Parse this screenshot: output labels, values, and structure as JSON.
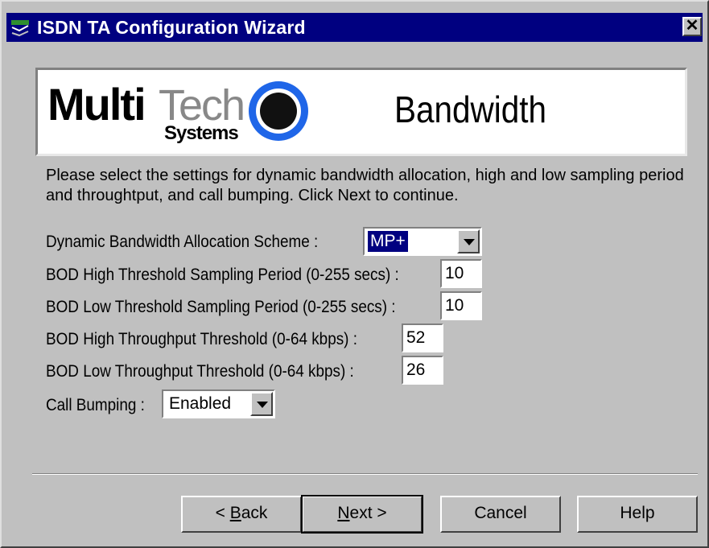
{
  "window": {
    "title": "ISDN TA Configuration Wizard",
    "close_label": "✕",
    "icon": "isdn-ta-app-icon"
  },
  "banner": {
    "logo_multi": "Multi",
    "logo_tech": "Tech",
    "logo_systems": "Systems",
    "page_title": "Bandwidth"
  },
  "instructions": "Please select the settings for dynamic bandwidth allocation, high and low sampling period and throughtput, and call bumping.  Click Next to continue.",
  "form": {
    "scheme": {
      "label": "Dynamic Bandwidth Allocation Scheme :",
      "value": "MP+"
    },
    "bod_high_period": {
      "label": "BOD High Threshold Sampling Period (0-255 secs) :",
      "value": "10"
    },
    "bod_low_period": {
      "label": "BOD Low Threshold Sampling Period (0-255 secs) :",
      "value": "10"
    },
    "bod_high_throughput": {
      "label": "BOD High Throughput Threshold (0-64 kbps) :",
      "value": "52"
    },
    "bod_low_throughput": {
      "label": "BOD Low Throughput Threshold (0-64 kbps) :",
      "value": "26"
    },
    "call_bumping": {
      "label": "Call Bumping :",
      "value": "Enabled"
    }
  },
  "buttons": {
    "back_prefix": "< ",
    "back_access": "B",
    "back_rest": "ack",
    "next_access": "N",
    "next_rest": "ext >",
    "cancel": "Cancel",
    "help": "Help"
  },
  "colors": {
    "titlebar": "#000080",
    "face": "#c0c0c0",
    "logo_blue": "#1f66e8"
  }
}
